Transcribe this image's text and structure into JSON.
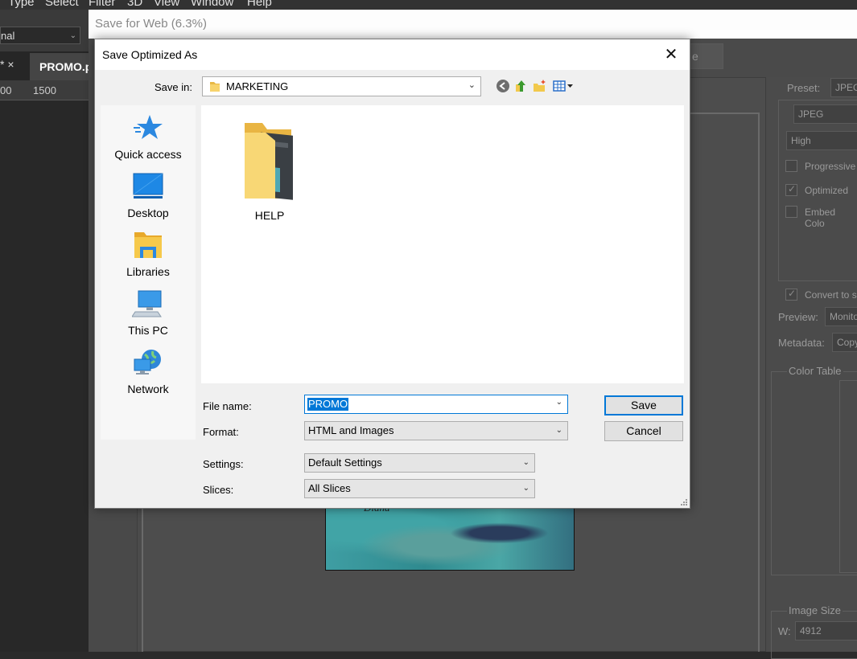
{
  "photoshop": {
    "menu": [
      "Type",
      "Select",
      "Filter",
      "3D",
      "View",
      "Window",
      "Help"
    ],
    "blend_mode": "nal",
    "tab_close": "* ×",
    "document_tab": "PROMO.p",
    "ruler_labels": [
      "00",
      "1500"
    ]
  },
  "save_for_web": {
    "title": "Save for Web (6.3%)",
    "toolbar_partial": "e",
    "image_text": "Diana",
    "right_panel": {
      "preset_label": "Preset:",
      "preset_value": "JPEG",
      "format_value": "JPEG",
      "quality_value": "High",
      "progressive_label": "Progressive",
      "optimized_label": "Optimized",
      "embed_label": "Embed Colo",
      "convert_label": "Convert to s",
      "preview_label": "Preview:",
      "preview_value": "Monito",
      "metadata_label": "Metadata:",
      "metadata_value": "Copy",
      "color_table_label": "Color Table",
      "image_size_label": "Image Size",
      "width_label": "W:",
      "width_value": "4912"
    }
  },
  "dialog": {
    "title": "Save Optimized As",
    "close_glyph": "✕",
    "save_in_label": "Save in:",
    "save_in_value": "MARKETING",
    "places": [
      {
        "label": "Quick access",
        "icon": "quick-access-star-icon"
      },
      {
        "label": "Desktop",
        "icon": "desktop-icon"
      },
      {
        "label": "Libraries",
        "icon": "libraries-icon"
      },
      {
        "label": "This PC",
        "icon": "this-pc-icon"
      },
      {
        "label": "Network",
        "icon": "network-icon"
      }
    ],
    "files": [
      {
        "name": "HELP",
        "icon": "folder-icon"
      }
    ],
    "file_name_label": "File name:",
    "file_name_value": "PROMO",
    "format_label": "Format:",
    "format_value": "HTML and Images",
    "settings_label": "Settings:",
    "settings_value": "Default Settings",
    "slices_label": "Slices:",
    "slices_value": "All Slices",
    "save_button": "Save",
    "cancel_button": "Cancel"
  },
  "colors": {
    "accent": "#0078d7",
    "dialog_bg": "#f0f0f0",
    "ps_dark": "#2b2b2b"
  }
}
